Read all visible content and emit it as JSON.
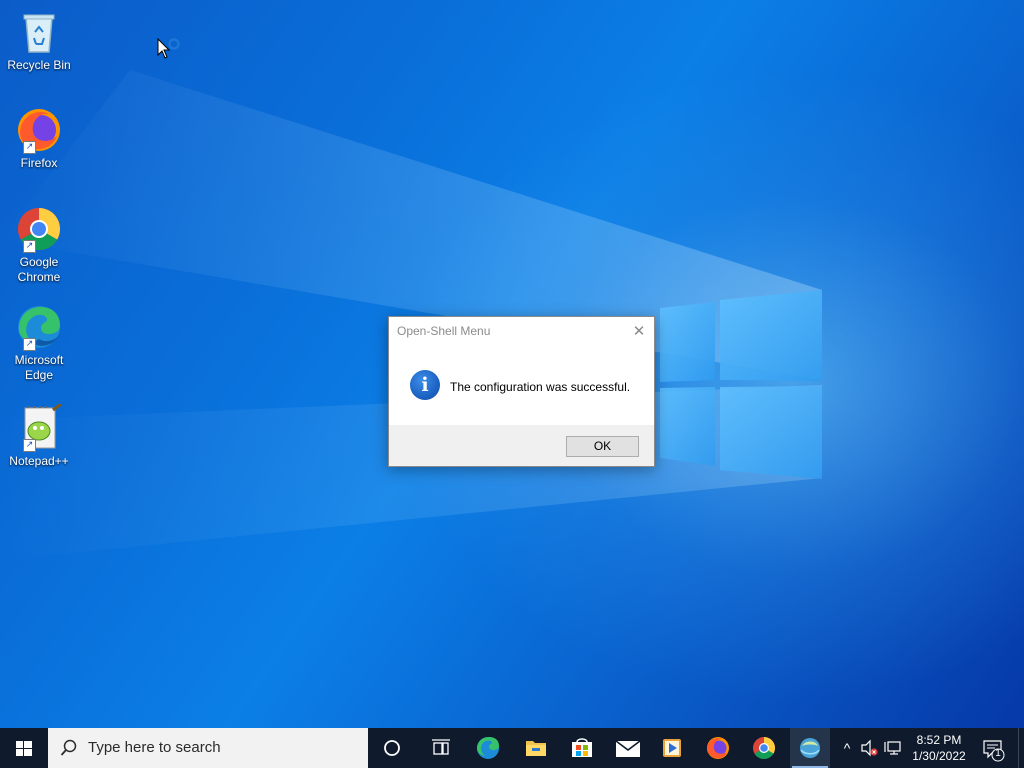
{
  "desktop": {
    "icons": [
      {
        "label": "Recycle Bin",
        "icon": "recycle-bin-icon"
      },
      {
        "label": "Firefox",
        "icon": "firefox-icon"
      },
      {
        "label": "Google Chrome",
        "icon": "chrome-icon"
      },
      {
        "label": "Microsoft Edge",
        "icon": "edge-icon"
      },
      {
        "label": "Notepad++",
        "icon": "notepadpp-icon"
      }
    ]
  },
  "dialog": {
    "title": "Open-Shell Menu",
    "close_glyph": "✕",
    "info_glyph": "i",
    "message": "The configuration was successful.",
    "ok_label": "OK"
  },
  "taskbar": {
    "search_placeholder": "Type here to search",
    "apps": [
      "cortana-icon",
      "task-view-icon",
      "edge-icon",
      "file-explorer-icon",
      "store-icon",
      "mail-icon",
      "media-player-icon",
      "firefox-icon",
      "chrome-icon",
      "open-shell-icon"
    ],
    "tray": {
      "time": "8:52 PM",
      "date": "1/30/2022",
      "notification_count": "1",
      "show_hidden_glyph": "^"
    }
  },
  "colors": {
    "taskbar_bg": "#0f1b2c",
    "accent": "#0078d7",
    "dialog_footer": "#f0f0f0"
  }
}
